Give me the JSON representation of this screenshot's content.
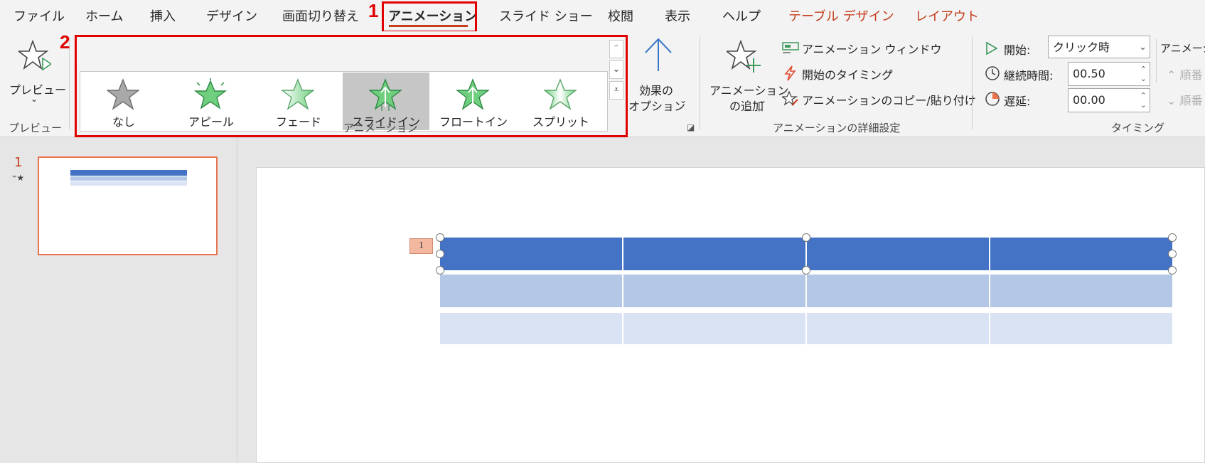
{
  "tabs": [
    "ファイル",
    "ホーム",
    "挿入",
    "デザイン",
    "画面切り替え",
    "アニメーション",
    "スライド ショー",
    "校閲",
    "表示",
    "ヘルプ",
    "テーブル デザイン",
    "レイアウト"
  ],
  "callouts": {
    "one": "1",
    "two": "2"
  },
  "preview": {
    "button": "プレビュー",
    "group": "プレビュー"
  },
  "gallery": {
    "items": [
      "なし",
      "アピール",
      "フェード",
      "スライドイン",
      "フロートイン",
      "スプリット"
    ],
    "selected": "スライドイン",
    "group": "アニメーション"
  },
  "effect_options": {
    "line1": "効果の",
    "line2": "オプション"
  },
  "advanced": {
    "add_line1": "アニメーション",
    "add_line2": "の追加",
    "pane": "アニメーション ウィンドウ",
    "trigger": "開始のタイミング",
    "painter": "アニメーションのコピー/貼り付け",
    "group": "アニメーションの詳細設定"
  },
  "timing": {
    "start_label": "開始:",
    "start_value": "クリック時",
    "duration_label": "継続時間:",
    "duration_value": "00.50",
    "delay_label": "遅延:",
    "delay_value": "00.00",
    "group": "タイミング",
    "reorder_title": "アニメーシ",
    "earlier": "順番",
    "later": "順番"
  },
  "slides": [
    {
      "number": "1",
      "has_animation": true
    }
  ],
  "table": {
    "animation_tag": "1",
    "columns": 4,
    "rows": 3
  },
  "colors": {
    "accent": "#c43e1c",
    "highlight": "#e00000",
    "header_row": "#4472c4",
    "row1": "#b4c7e7",
    "row2": "#dae3f3",
    "star_green": "#6fcf7f"
  }
}
